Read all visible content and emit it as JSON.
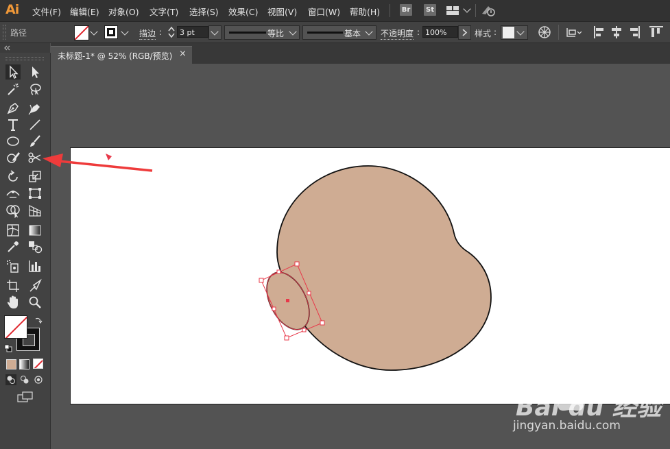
{
  "app": {
    "logo": "Ai"
  },
  "menu": {
    "items": [
      "文件(F)",
      "编辑(E)",
      "对象(O)",
      "文字(T)",
      "选择(S)",
      "效果(C)",
      "视图(V)",
      "窗口(W)",
      "帮助(H)"
    ],
    "bridge_label": "Br",
    "stock_label": "St"
  },
  "control_bar": {
    "selection_label": "路径",
    "stroke_label": "描边",
    "stroke_colon": ":",
    "stroke_weight": "3 pt",
    "profile_label": "等比",
    "brush_label": "基本",
    "opacity_label": "不透明度",
    "opacity_value": "100%",
    "style_label": "样式"
  },
  "document": {
    "tab_title": "未标题-1* @ 52% (RGB/预览)",
    "tab_close": "×"
  },
  "toolbox": {
    "icons": [
      "selection-tool-icon",
      "direct-selection-tool-icon",
      "magic-wand-tool-icon",
      "lasso-tool-icon",
      "pen-tool-icon",
      "curvature-tool-icon",
      "type-tool-icon",
      "line-segment-tool-icon",
      "ellipse-tool-icon",
      "paintbrush-tool-icon",
      "shaper-tool-icon",
      "scissors-tool-icon",
      "rotate-tool-icon",
      "scale-tool-icon",
      "width-tool-icon",
      "free-transform-tool-icon",
      "shape-builder-tool-icon",
      "perspective-grid-tool-icon",
      "mesh-tool-icon",
      "gradient-tool-icon",
      "eyedropper-tool-icon",
      "blend-tool-icon",
      "symbol-sprayer-tool-icon",
      "column-graph-tool-icon",
      "artboard-tool-icon",
      "slice-tool-icon",
      "hand-tool-icon",
      "zoom-tool-icon"
    ]
  },
  "colors": {
    "shape_fill": "#cfac93",
    "selection_red": "#e8394a",
    "arrow_red": "#ee3b3b",
    "logo_orange": "#f09838"
  },
  "watermark": {
    "main_text": "Bai du 经验",
    "sub_text": "jingyan.baidu.com"
  }
}
